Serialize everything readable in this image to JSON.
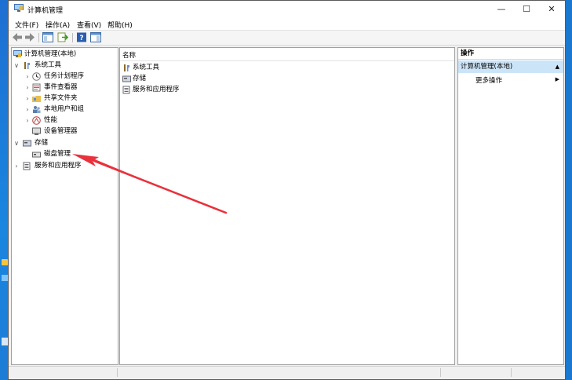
{
  "window": {
    "title": "计算机管理",
    "minimize_glyph": "—",
    "maximize_glyph": "☐",
    "close_glyph": "✕"
  },
  "menu": [
    {
      "label": "文件(F)"
    },
    {
      "label": "操作(A)"
    },
    {
      "label": "查看(V)"
    },
    {
      "label": "帮助(H)"
    }
  ],
  "toolbar": {
    "icons": [
      "back-arrow-icon",
      "forward-arrow-icon",
      "show-hide-console-tree-icon",
      "export-list-icon",
      "help-icon",
      "action-pane-icon"
    ]
  },
  "tree": {
    "root": "计算机管理(本地)",
    "system_tools": "系统工具",
    "task_scheduler": "任务计划程序",
    "event_viewer": "事件查看器",
    "shared_folders": "共享文件夹",
    "local_users": "本地用户和组",
    "performance": "性能",
    "device_manager": "设备管理器",
    "storage": "存储",
    "disk_management": "磁盘管理",
    "services_apps": "服务和应用程序"
  },
  "list": {
    "column_header": "名称",
    "items": [
      "系统工具",
      "存储",
      "服务和应用程序"
    ]
  },
  "actions": {
    "header": "操作",
    "section": "计算机管理(本地)",
    "more": "更多操作"
  },
  "colors": {
    "selection": "#cce4f7",
    "annotation_arrow": "#e8323c"
  }
}
